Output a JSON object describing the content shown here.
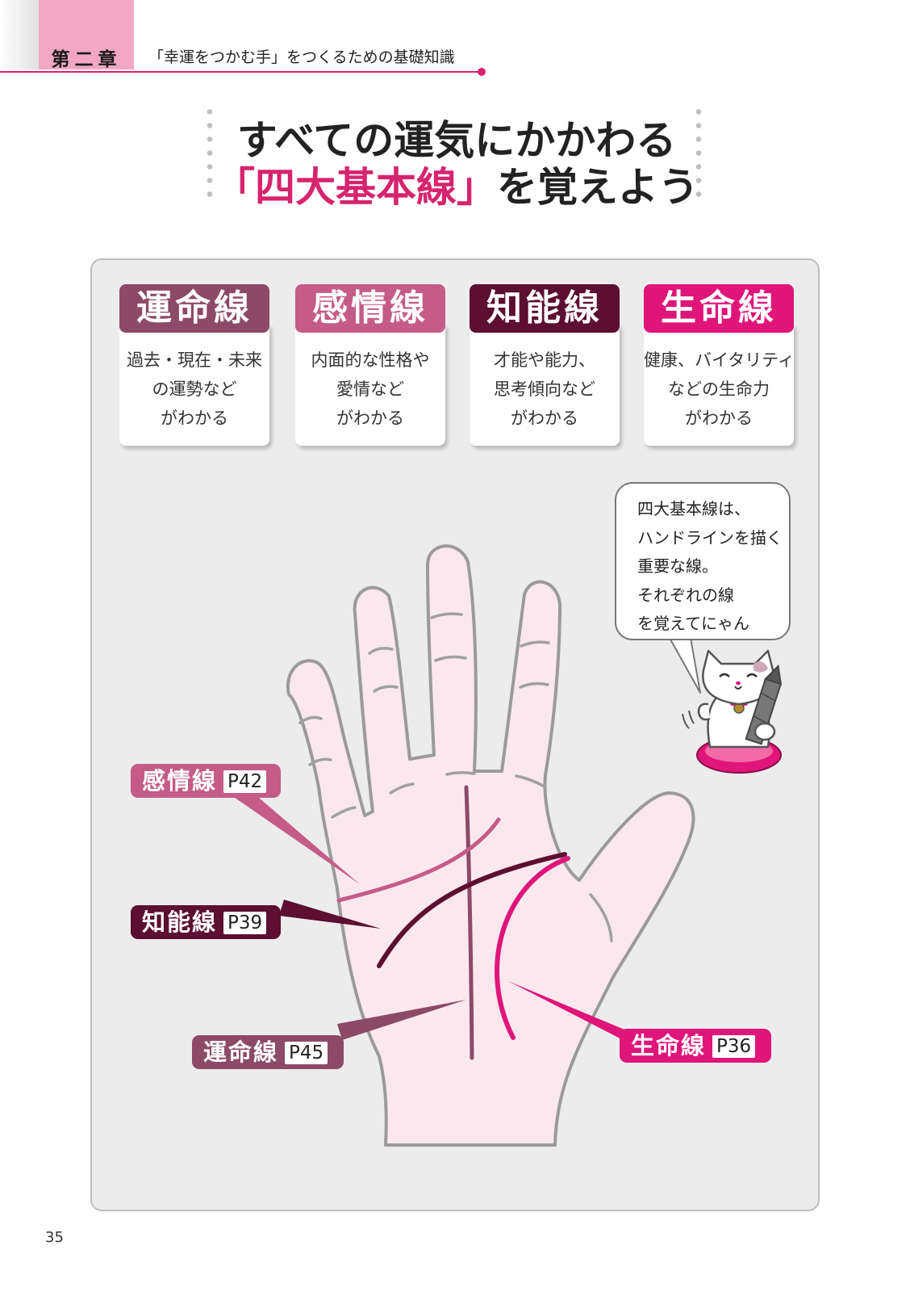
{
  "header": {
    "chapter_label": "第二章",
    "chapter_subtitle": "「幸運をつかむ手」をつくるための基礎知識"
  },
  "title": {
    "line1": "すべての運気にかかわる",
    "line2_highlight": "「四大基本線」",
    "line2_rest": "を覚えよう"
  },
  "cards": [
    {
      "name": "運命線",
      "lines": [
        "過去・現在・未来",
        "の運勢など",
        "がわかる"
      ],
      "color": "#8c4a67"
    },
    {
      "name": "感情線",
      "lines": [
        "内面的な性格や",
        "愛情など",
        "がわかる"
      ],
      "color": "#c45c87"
    },
    {
      "name": "知能線",
      "lines": [
        "才能や能力、",
        "思考傾向など",
        "がわかる"
      ],
      "color": "#5c0f30"
    },
    {
      "name": "生命線",
      "lines": [
        "健康、バイタリティ",
        "などの生命力",
        "がわかる"
      ],
      "color": "#e0157a"
    }
  ],
  "bubble": {
    "lines": [
      "四大基本線は、",
      "ハンドラインを描く",
      "重要な線。",
      "それぞれの線",
      "を覚えてにゃん"
    ]
  },
  "labels": {
    "emotion": {
      "name": "感情線",
      "page": "P42"
    },
    "intellect": {
      "name": "知能線",
      "page": "P39"
    },
    "fate": {
      "name": "運命線",
      "page": "P45"
    },
    "life": {
      "name": "生命線",
      "page": "P36"
    }
  },
  "colors": {
    "accent": "#d6246e",
    "fate": "#8c4a67",
    "emotion": "#c45c87",
    "intellect": "#5c0f30",
    "life": "#e0157a",
    "palm_fill": "#fbe8ef"
  },
  "page_number": "35"
}
